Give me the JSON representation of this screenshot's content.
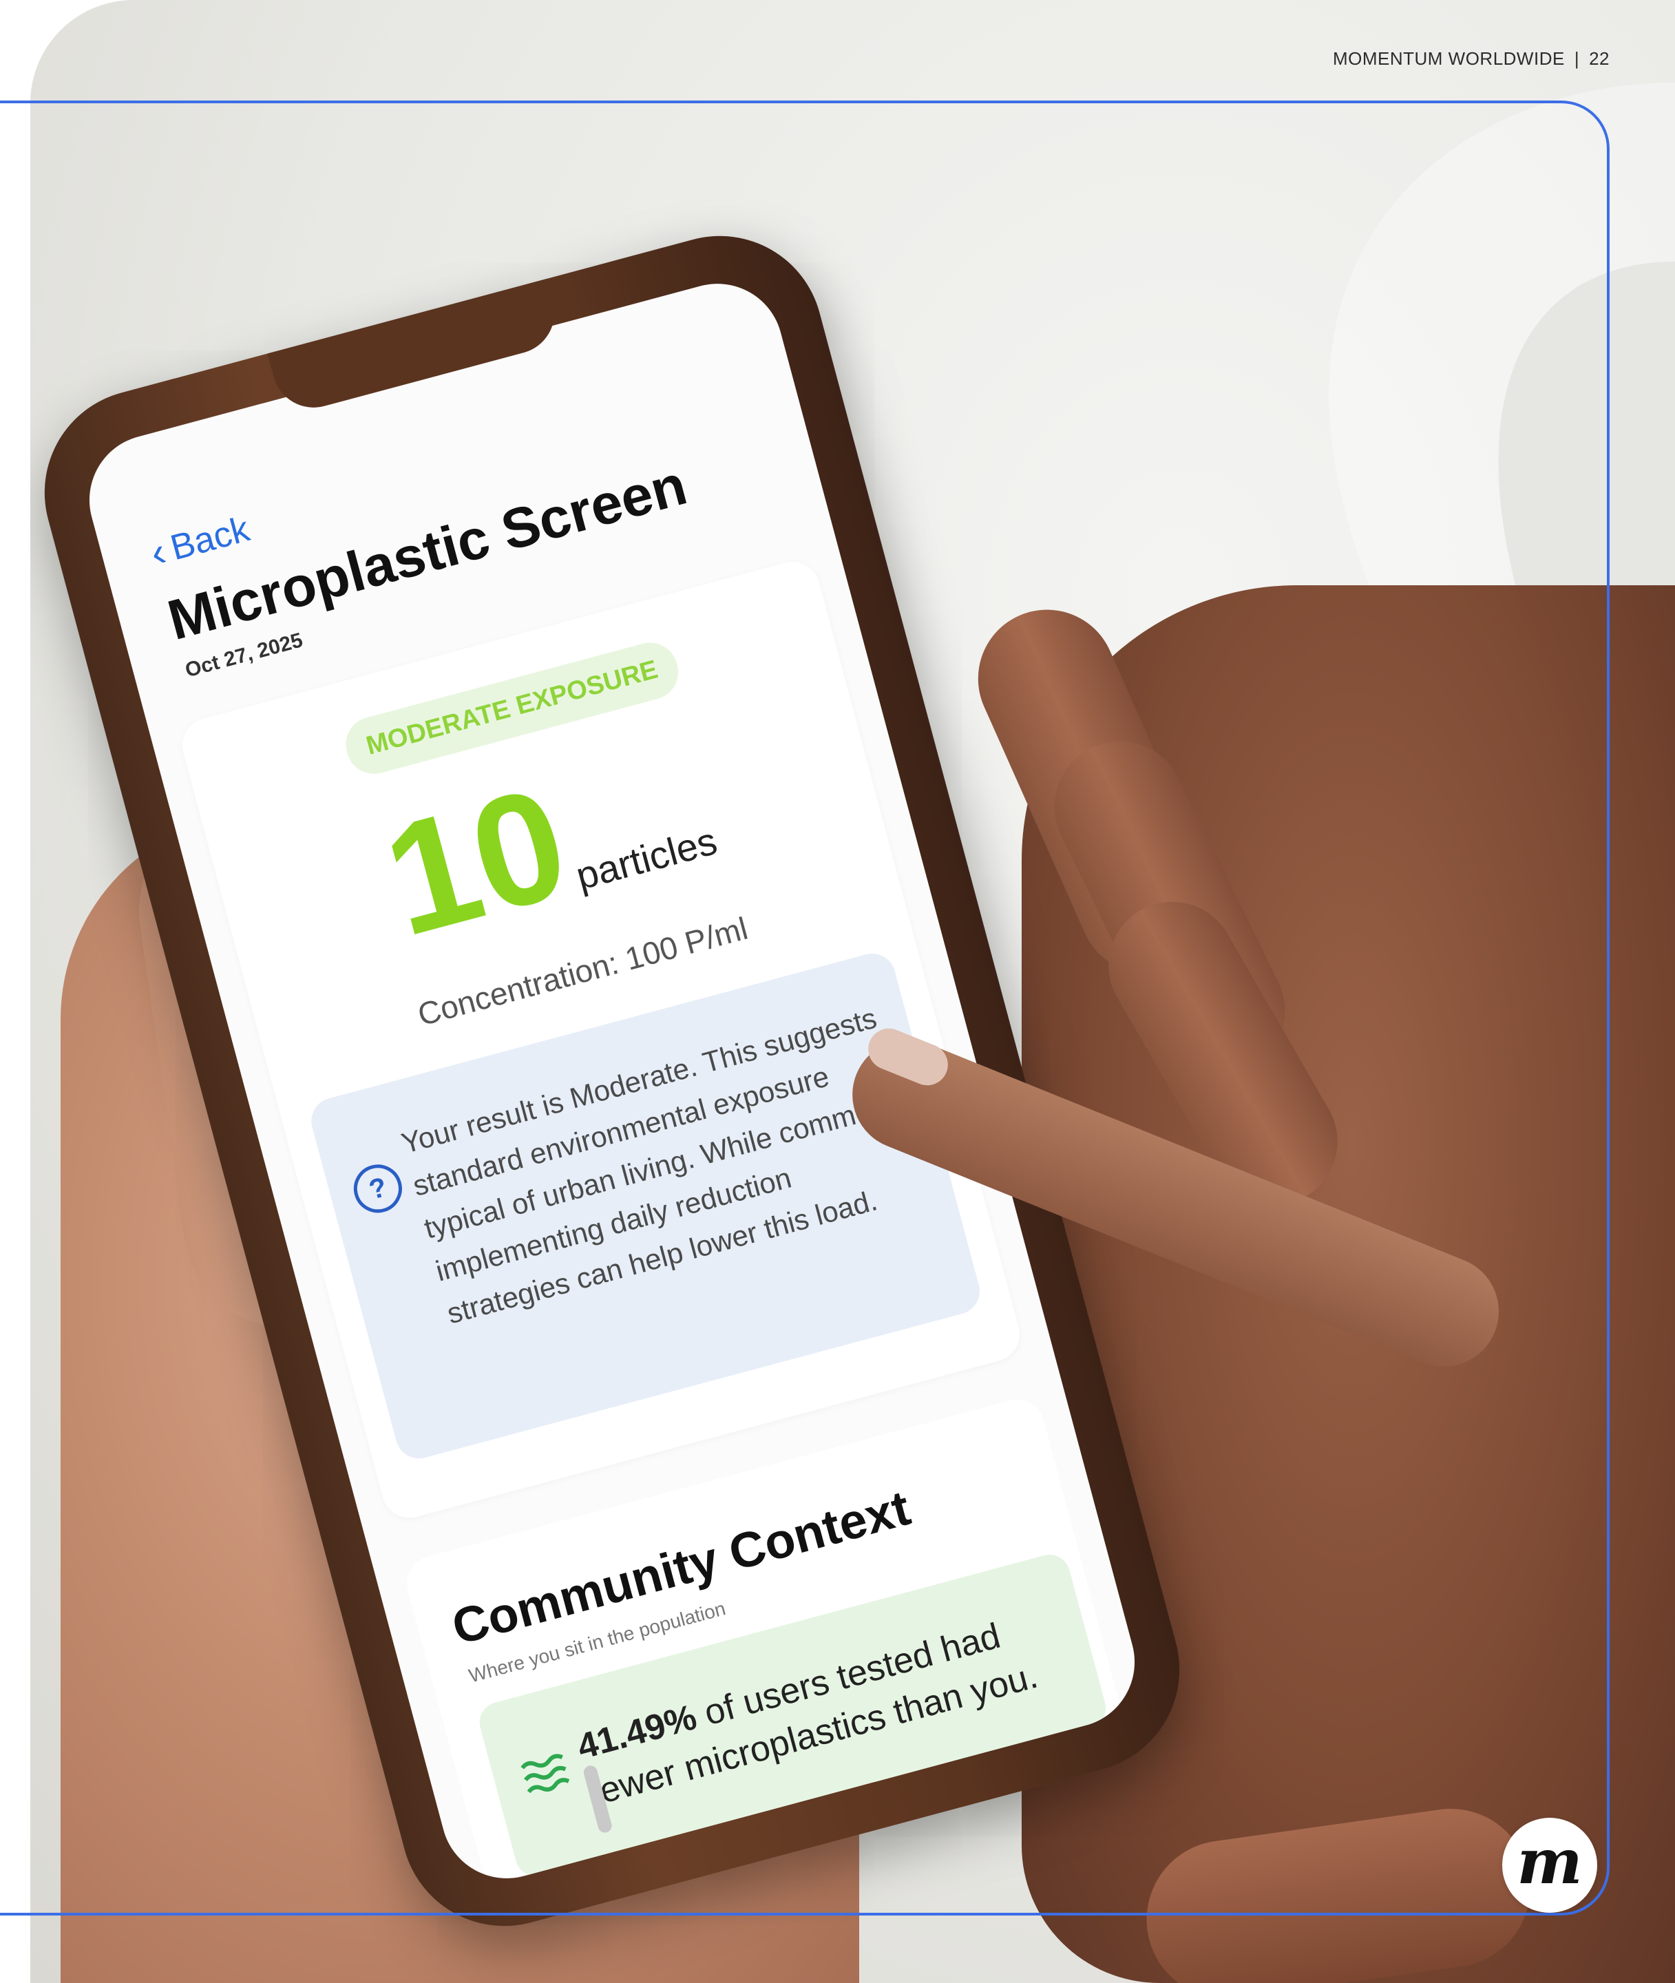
{
  "header": {
    "brand": "MOMENTUM WORLDWIDE",
    "separator": "|",
    "page_number": "22"
  },
  "colors": {
    "frame_accent": "#3c6ee6",
    "exposure_green": "#8ad41f",
    "link_blue": "#2a6ee0",
    "info_bg": "#e7eef8",
    "stat_bg": "#e6f5e3"
  },
  "phone_app": {
    "back_label": "Back",
    "title": "Microplastic Screen",
    "date": "Oct 27, 2025",
    "result": {
      "badge": "MODERATE EXPOSURE",
      "count": "10",
      "count_unit": "particles",
      "concentration": "Concentration: 100 P/ml",
      "info_icon": "question-circle-icon",
      "info_text": "Your result is Moderate. This suggests standard environmental exposure typical of urban living. While common, implementing daily reduction strategies can help lower this load."
    },
    "community": {
      "title": "Community Context",
      "subtitle": "Where you sit in the population",
      "stat_icon": "waves-icon",
      "stat_highlight": "41.49%",
      "stat_rest": " of users tested had fewer microplastics than you."
    }
  },
  "logo": {
    "letter": "m"
  }
}
